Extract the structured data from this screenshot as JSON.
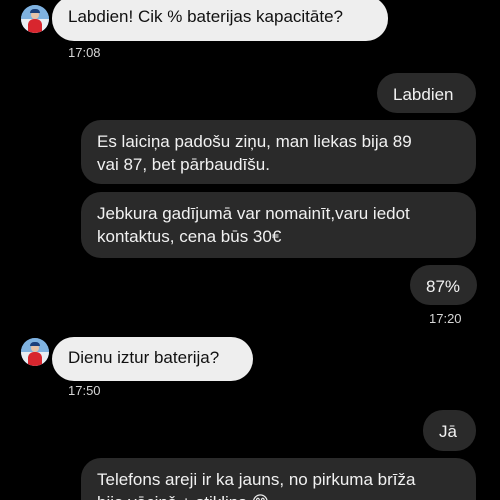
{
  "messages": [
    {
      "text": "Labdien! Cik % baterijas kapacitāte?",
      "time": "17:08"
    },
    {
      "text": "Labdien"
    },
    {
      "text": "Es laiciņa padošu ziņu, man liekas bija 89\nvai 87, bet pārbaudīšu."
    },
    {
      "text": "Jebkura gadījumā var nomainīt,varu iedot\nkontaktus, cena būs 30€"
    },
    {
      "text": "87%",
      "time": "17:20"
    },
    {
      "text": "Dienu iztur baterija?",
      "time": "17:50"
    },
    {
      "text": "Jā"
    },
    {
      "text": "Telefons areji ir ka jauns, no pirkuma brīža\nbija vāciņš + stikliņs 😊"
    }
  ]
}
